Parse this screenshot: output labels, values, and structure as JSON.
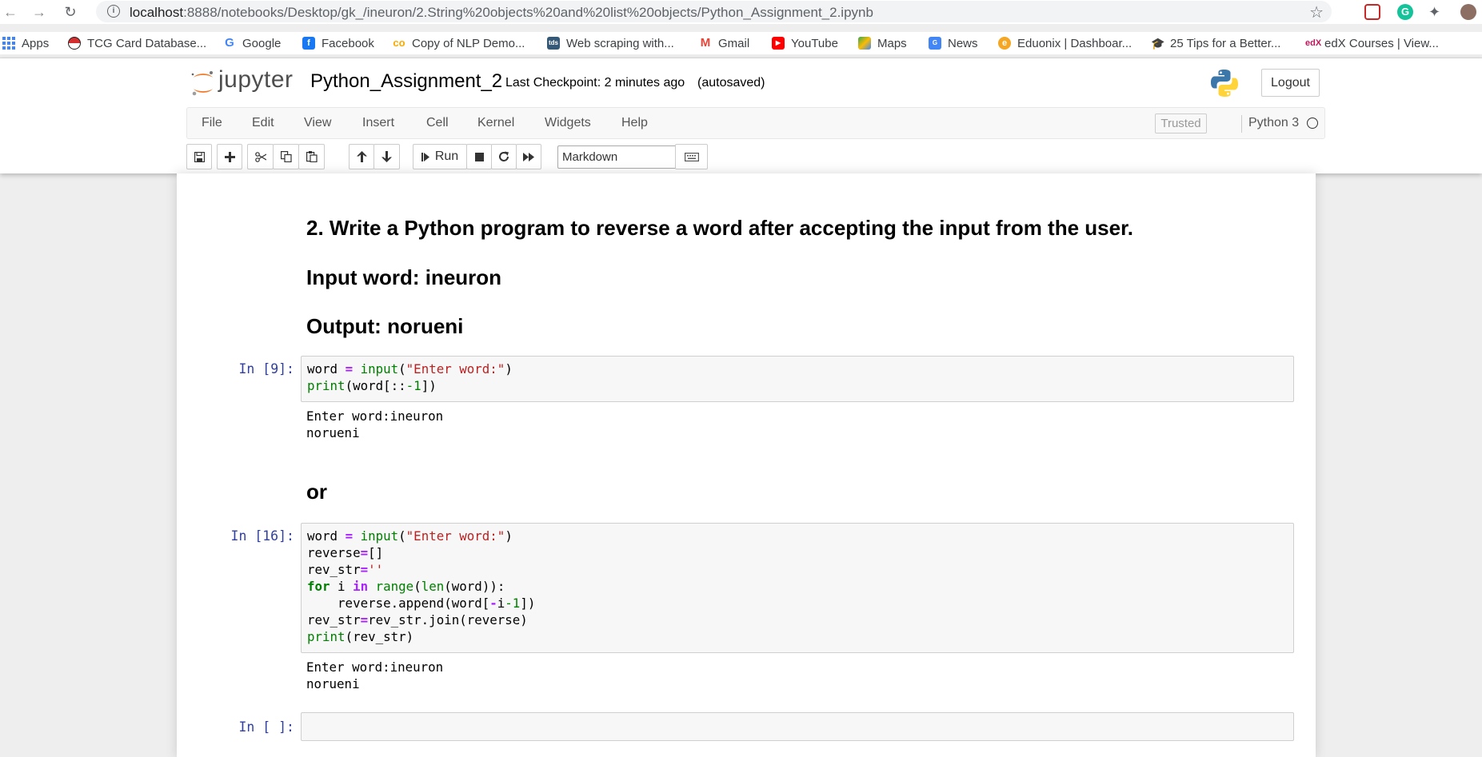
{
  "browser": {
    "url_host": "localhost",
    "url_path": ":8888/notebooks/Desktop/gk_/ineuron/2.String%20objects%20and%20list%20objects/Python_Assignment_2.ipynb",
    "bookmarks": [
      {
        "label": "Apps",
        "icon": "apps-grid-icon",
        "color": "#4285f4"
      },
      {
        "label": "TCG Card Database...",
        "icon": "pokeball-icon",
        "color": "#d32f2f"
      },
      {
        "label": "Google",
        "icon": "google-icon",
        "color": "#4285f4"
      },
      {
        "label": "Facebook",
        "icon": "facebook-icon",
        "color": "#1877f2"
      },
      {
        "label": "Copy of NLP Demo...",
        "icon": "colab-icon",
        "color": "#f9ab00"
      },
      {
        "label": "Web scraping with...",
        "icon": "tds-icon",
        "color": "#355876"
      },
      {
        "label": "Gmail",
        "icon": "gmail-icon",
        "color": "#ea4335"
      },
      {
        "label": "YouTube",
        "icon": "youtube-icon",
        "color": "#ff0000"
      },
      {
        "label": "Maps",
        "icon": "maps-icon",
        "color": "#34a853"
      },
      {
        "label": "News",
        "icon": "news-icon",
        "color": "#4285f4"
      },
      {
        "label": "Eduonix | Dashboar...",
        "icon": "eduonix-icon",
        "color": "#f5a623"
      },
      {
        "label": "25 Tips for a Better...",
        "icon": "graduation-cap-icon",
        "color": "#222222"
      },
      {
        "label": "edX Courses | View...",
        "icon": "edx-icon",
        "color": "#c4145c"
      }
    ]
  },
  "jupyter": {
    "logo_text": "jupyter",
    "notebook_title": "Python_Assignment_2",
    "checkpoint": "Last Checkpoint: 2 minutes ago",
    "autosave": "(autosaved)",
    "logout_label": "Logout",
    "menu": [
      "File",
      "Edit",
      "View",
      "Insert",
      "Cell",
      "Kernel",
      "Widgets",
      "Help"
    ],
    "trusted_label": "Trusted",
    "kernel_name": "Python 3",
    "run_label": "Run",
    "cell_type": "Markdown",
    "accent_color": "#f37726"
  },
  "cells": {
    "heading_question": "2. Write a Python program to reverse a word after accepting the input from the user.",
    "heading_input": "Input word: ineuron",
    "heading_output": "Output: norueni",
    "cell1_prompt": "In [9]:",
    "cell1_output_1": "Enter word:ineuron",
    "cell1_output_2": "norueni",
    "heading_or": "or",
    "cell2_prompt": "In [16]:",
    "cell2_output_1": "Enter word:ineuron",
    "cell2_output_2": "norueni",
    "cell3_prompt": "In [ ]:"
  },
  "code": {
    "c1_l1_a": "word ",
    "c1_l1_op": "=",
    "c1_l1_sp": " ",
    "c1_l1_fn": "input",
    "c1_l1_p1": "(",
    "c1_l1_str": "\"Enter word:\"",
    "c1_l1_p2": ")",
    "c1_l2_fn": "print",
    "c1_l2_a": "(word[::",
    "c1_l2_num": "-1",
    "c1_l2_b": "])",
    "c2_l1_a": "word ",
    "c2_l1_op": "=",
    "c2_l1_sp": " ",
    "c2_l1_fn": "input",
    "c2_l1_p1": "(",
    "c2_l1_str": "\"Enter word:\"",
    "c2_l1_p2": ")",
    "c2_l2_a": "reverse",
    "c2_l2_op": "=",
    "c2_l2_b": "[]",
    "c2_l3_a": "rev_str",
    "c2_l3_op": "=",
    "c2_l3_str": "''",
    "c2_l4_kw1": "for",
    "c2_l4_a": " i ",
    "c2_l4_kw2": "in",
    "c2_l4_sp": " ",
    "c2_l4_fn1": "range",
    "c2_l4_p": "(",
    "c2_l4_fn2": "len",
    "c2_l4_b": "(word)):",
    "c2_l5_a": "    reverse.append(word[",
    "c2_l5_op": "-",
    "c2_l5_b": "i",
    "c2_l5_num": "-1",
    "c2_l5_c": "])",
    "c2_l6_a": "rev_str",
    "c2_l6_op": "=",
    "c2_l6_b": "rev_str.join(reverse)",
    "c2_l7_fn": "print",
    "c2_l7_a": "(rev_str)"
  }
}
